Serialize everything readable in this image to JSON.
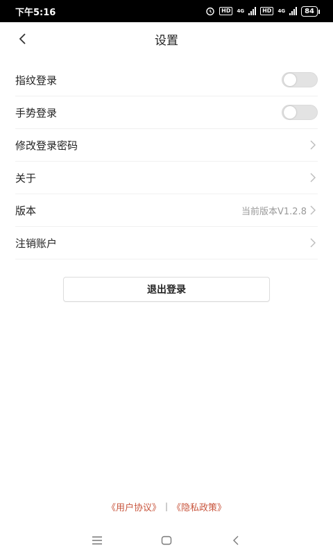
{
  "status_bar": {
    "time": "下午5:16",
    "hd1": "HD",
    "net1": "4G",
    "hd2": "HD",
    "net2": "4G",
    "battery": "84"
  },
  "header": {
    "title": "设置"
  },
  "settings": {
    "items": [
      {
        "label": "指纹登录",
        "control": "toggle",
        "on": false
      },
      {
        "label": "手势登录",
        "control": "toggle",
        "on": false
      },
      {
        "label": "修改登录密码",
        "control": "chevron"
      },
      {
        "label": "关于",
        "control": "chevron"
      },
      {
        "label": "版本",
        "control": "chevron",
        "value": "当前版本V1.2.8"
      },
      {
        "label": "注销账户",
        "control": "chevron"
      }
    ]
  },
  "logout_label": "退出登录",
  "footer": {
    "user_agreement": "《用户协议》",
    "separator": "|",
    "privacy_policy": "《隐私政策》"
  },
  "colors": {
    "link": "#c8553d",
    "toggle_off": "#e3e3e3",
    "status_bar": "#000000"
  },
  "icons": {
    "back": "chevron-left-icon",
    "row_arrow": "chevron-right-icon",
    "nav_menu": "menu-icon",
    "nav_home": "home-icon",
    "nav_back": "back-icon"
  }
}
